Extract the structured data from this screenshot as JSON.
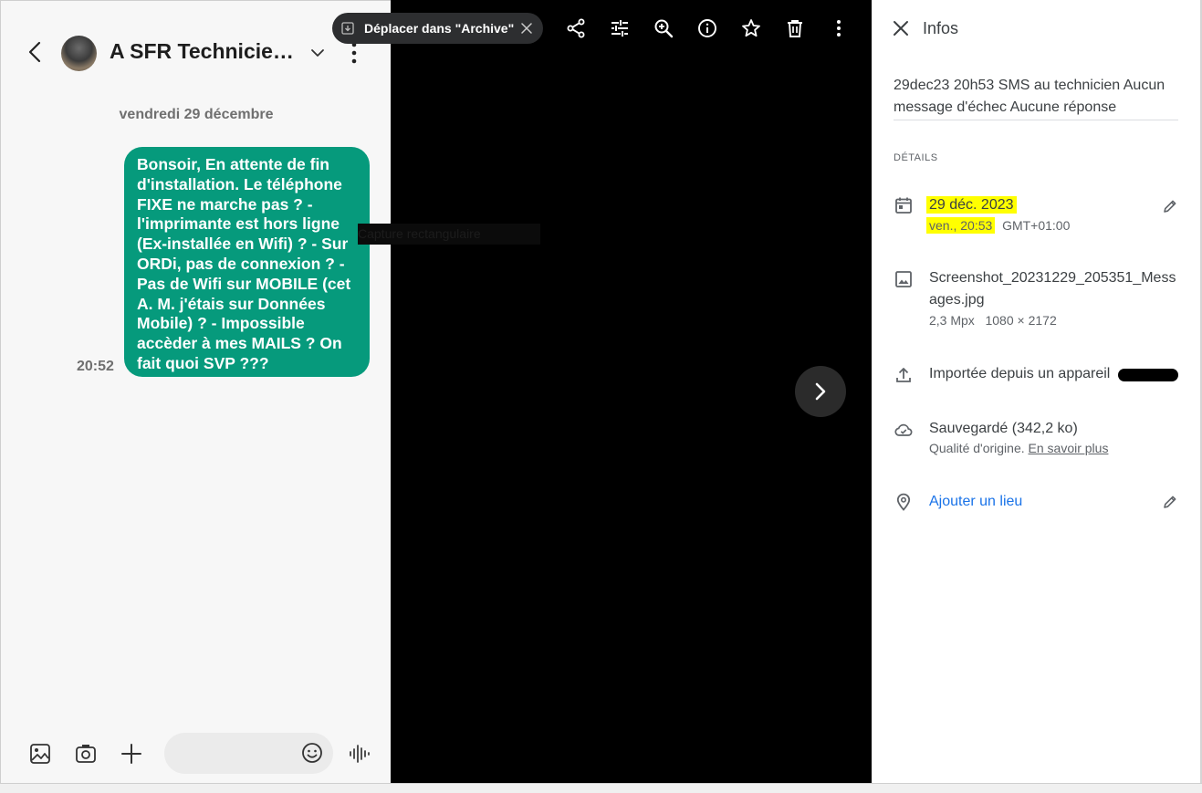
{
  "phone": {
    "contact_name": "A SFR Technicie…",
    "date_separator": "vendredi 29 décembre",
    "message": {
      "time": "20:52",
      "lines": [
        "Bonsoir, En attente de fin",
        "d'installation. Le téléphone",
        "FIXE ne marche pas ? -",
        "l'imprimante est hors ligne",
        "(Ex-installée en Wifi) ? - Sur",
        "ORDi, pas de connexion ? -",
        "Pas de Wifi sur MOBILE (cet",
        "A. M. j'étais sur Données",
        "Mobile) ? - Impossible",
        "accèder à mes MAILS ? On",
        "fait quoi SVP ???"
      ],
      "bubble_color": "#069a7c"
    },
    "bottom_icons": [
      "gallery-icon",
      "camera-icon",
      "plus-icon",
      "emoji-icon",
      "voice-icon"
    ]
  },
  "viewer": {
    "archive_chip_label": "Déplacer dans \"Archive\"",
    "ghost_label": "Capture rectangulaire",
    "toolbar_icons": [
      "share-icon",
      "tune-icon",
      "zoom-in-icon",
      "info-icon",
      "star-icon",
      "trash-icon",
      "more-icon"
    ]
  },
  "info": {
    "title": "Infos",
    "description": "29dec23  20h53 SMS au technicien  Aucun message d'échec  Aucune réponse",
    "details_header": "DÉTAILS",
    "date": {
      "main": "29 déc. 2023",
      "time": "ven., 20:53",
      "timezone": "GMT+01:00"
    },
    "file": {
      "name_line1": "Screenshot_20231229_205351_Mess",
      "name_line2": "ages.jpg",
      "megapixels": "2,3 Mpx",
      "dimensions": "1080 × 2172"
    },
    "upload": {
      "label": "Importée depuis un appareil"
    },
    "backup": {
      "label": "Sauvegardé (342,2 ko)",
      "quality": "Qualité d'origine.",
      "learn_more": "En savoir plus"
    },
    "location": {
      "label": "Ajouter un lieu"
    },
    "highlight_color": "#ffff00",
    "link_color": "#1a73e8"
  }
}
